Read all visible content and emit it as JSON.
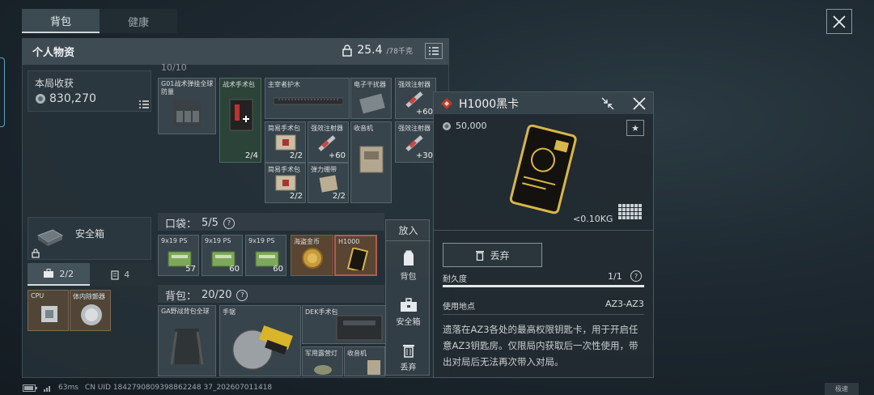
{
  "tabs": {
    "bag": "背包",
    "health": "健康"
  },
  "panel": {
    "title": "个人物资",
    "weight_value": "25.4",
    "weight_max": "/78千克",
    "income_label": "本局收获",
    "income_value": "830,270",
    "safebox_label": "安全箱",
    "safe_tab1_count": "2/2",
    "safe_tab2_count": "4"
  },
  "vest_items": {
    "header_partial": "10/10",
    "g01_name": "G01战术弹挂全球防量",
    "medkit_name": "战术手术包",
    "medkit_count": "2/4",
    "armor_name": "主宰者护木",
    "jammer_name": "电子干扰器",
    "strong_injector_1": "强效注射器",
    "strong_injector_1_count": "+60",
    "simple_medkit_1": "简易手术包",
    "simple_medkit_1_count": "2/2",
    "strong_injector_2": "强效注射器",
    "strong_injector_2_count": "+60",
    "radio_name": "收音机",
    "strong_injector_3": "强效注射器",
    "strong_injector_3_count": "+30",
    "simple_medkit_2": "简易手术包",
    "simple_medkit_2_count": "2/2",
    "ammo_box_name": "弹力绷带",
    "ammo_box_count": "2/2"
  },
  "pocket": {
    "label": "口袋：",
    "count": "5/5",
    "items": [
      {
        "name": "9x19 PS",
        "count": "57"
      },
      {
        "name": "9x19 PS",
        "count": "60"
      },
      {
        "name": "9x19 PS",
        "count": "60"
      },
      {
        "name": "海盗金币",
        "count": ""
      },
      {
        "name": "H1000",
        "count": ""
      }
    ]
  },
  "backpack": {
    "label": "背包：",
    "count": "20/20",
    "items": [
      {
        "name": "GA野战背包全球"
      },
      {
        "name": "手锯"
      },
      {
        "name": "DEK手术包"
      },
      {
        "name": "军用露营灯"
      },
      {
        "name": "收音机"
      }
    ]
  },
  "actions": {
    "header": "放入",
    "bag": "背包",
    "safebox": "安全箱",
    "discard": "丢弃"
  },
  "detail": {
    "title": "H1000黑卡",
    "price": "50,000",
    "weight": "<0.10KG",
    "discard_label": "丢弃",
    "durability_label": "耐久度",
    "durability_value": "1/1",
    "durability_fraction": 1.0,
    "location_label": "使用地点",
    "location_value": "AZ3-AZ3",
    "description": "遗落在AZ3各处的最高权限钥匙卡，用于开启任意AZ3钥匙房。仅限局内获取后一次性使用，带出对局后无法再次带入对局。"
  },
  "status": {
    "ping": "63ms",
    "uid": "CN UID 1842790809398862248 37_202607011418"
  },
  "corner_btn": "极速",
  "colors": {
    "accent_red": "#c0392b",
    "gold": "#d9b64a",
    "panel_head": "#3e4b53"
  }
}
